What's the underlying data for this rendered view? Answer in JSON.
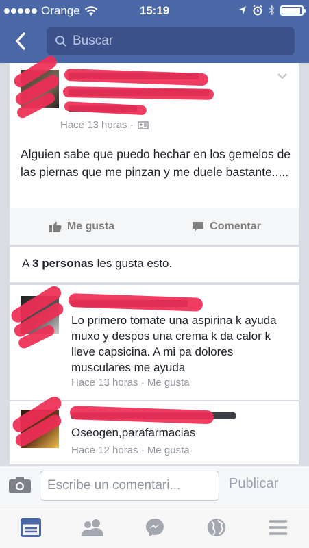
{
  "status_bar": {
    "carrier": "Orange",
    "time": "15:19",
    "battery_level": 0.85
  },
  "header": {
    "back_icon": "chevron-left-icon",
    "search_placeholder": "Buscar"
  },
  "post": {
    "meta": "Hace 13 horas ·",
    "text": "Alguien sabe que puedo hechar  en los gemelos de las piernas que me pinzan y me duele bastante.....",
    "actions": {
      "like_label": "Me gusta",
      "comment_label": "Comentar"
    }
  },
  "likes": {
    "prefix": "A ",
    "bold": "3 personas",
    "suffix": " les gusta esto."
  },
  "comments": [
    {
      "text": "Lo primero tomate una aspirina k ayuda muxo y despos una crema k da calor k lleve capsicina. A mi pa dolores musculares me ayuda",
      "meta": "Hace 13 horas · Me gusta"
    },
    {
      "text": "Oseogen,parafarmacias",
      "meta": "Hace 12 horas · Me gusta"
    }
  ],
  "composer": {
    "placeholder": "Escribe un comentari...",
    "publish_label": "Publicar"
  },
  "tabbar": {
    "icons": [
      "news-feed-icon",
      "friends-icon",
      "messenger-icon",
      "globe-icon",
      "menu-icon"
    ]
  },
  "colors": {
    "brand": "#4a67a6",
    "redaction": "#ee2d55"
  }
}
